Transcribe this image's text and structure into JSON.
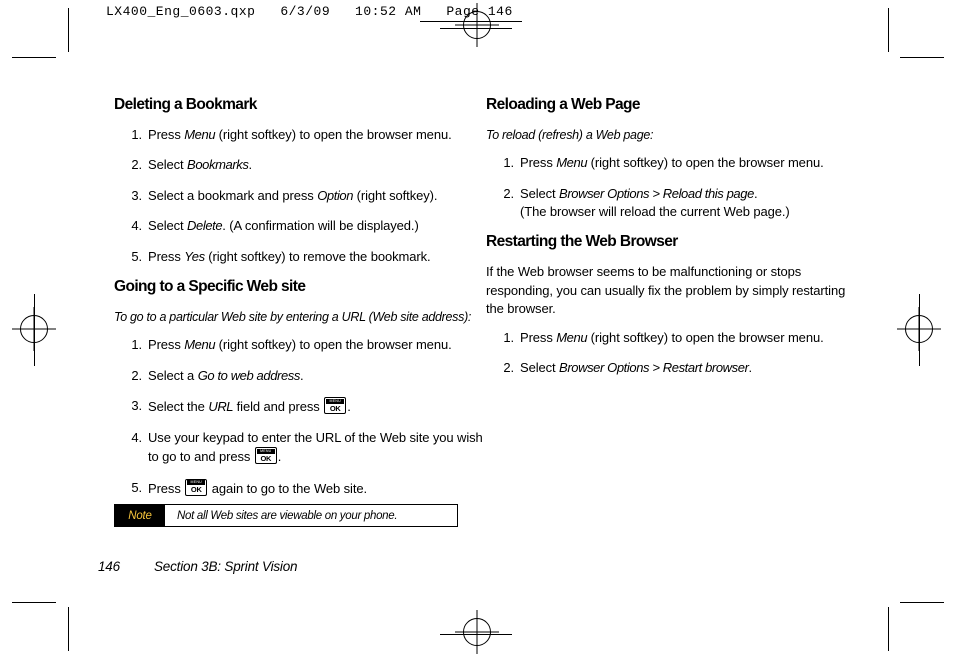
{
  "header": {
    "slug": "LX400_Eng_0603.qxp   6/3/09   10:52 AM   Page 146"
  },
  "left_column": {
    "section1": {
      "heading": "Deleting a Bookmark",
      "steps": [
        {
          "pre": "Press ",
          "em": "Menu",
          "post": " (right softkey) to open the browser menu."
        },
        {
          "pre": "Select ",
          "em": "Bookmarks",
          "post": "."
        },
        {
          "pre": "Select a bookmark and press ",
          "em": "Option",
          "post": " (right softkey)."
        },
        {
          "pre": "Select ",
          "em": "Delete",
          "post": ". (A confirmation will be displayed.)"
        },
        {
          "pre": "Press ",
          "em": "Yes",
          "post": " (right softkey) to remove the bookmark."
        }
      ]
    },
    "section2": {
      "heading": "Going to a Specific Web site",
      "lead": "To go to a particular Web site by entering a URL (Web site address):",
      "steps": [
        {
          "pre": "Press ",
          "em": "Menu",
          "post": " (right softkey) to open the browser menu."
        },
        {
          "pre": "Select a ",
          "em": "Go to web address",
          "post": "."
        },
        {
          "pre": "Select the ",
          "em": "URL",
          "post": " field and press ",
          "key": "OK",
          "tail": "."
        },
        {
          "pre": "Use your keypad to enter the URL of the Web site you wish to go to and press ",
          "key": "OK",
          "tail": "."
        },
        {
          "pre": "Press ",
          "key": "OK",
          "tail": " again to go to the Web site."
        }
      ]
    },
    "note": {
      "tag": "Note",
      "text": "Not all Web sites are viewable on your phone."
    }
  },
  "right_column": {
    "section1": {
      "heading": "Reloading a Web Page",
      "lead": "To reload (refresh) a Web page:",
      "steps": [
        {
          "pre": "Press ",
          "em": "Menu",
          "post": " (right softkey) to open the browser menu."
        },
        {
          "pre": "Select ",
          "em": "Browser Options > Reload this page",
          "post": ".",
          "extra": "(The browser will reload the current Web page.)"
        }
      ]
    },
    "section2": {
      "heading": "Restarting the Web Browser",
      "body": "If the Web browser seems to be malfunctioning or stops responding, you can usually fix the problem by simply restarting the browser.",
      "steps": [
        {
          "pre": "Press ",
          "em": "Menu",
          "post": " (right softkey) to open the browser menu."
        },
        {
          "pre": "Select ",
          "em": "Browser Options > Restart browser",
          "post": "."
        }
      ]
    }
  },
  "footer": {
    "page_number": "146",
    "section_label": "Section 3B: Sprint Vision"
  },
  "okkey": {
    "menu_label": "MENU",
    "ok_label": "OK"
  },
  "colors": {
    "note_tag_text": "#f5c33b",
    "note_tag_bg": "#000000",
    "page_bg": "#ffffff"
  }
}
